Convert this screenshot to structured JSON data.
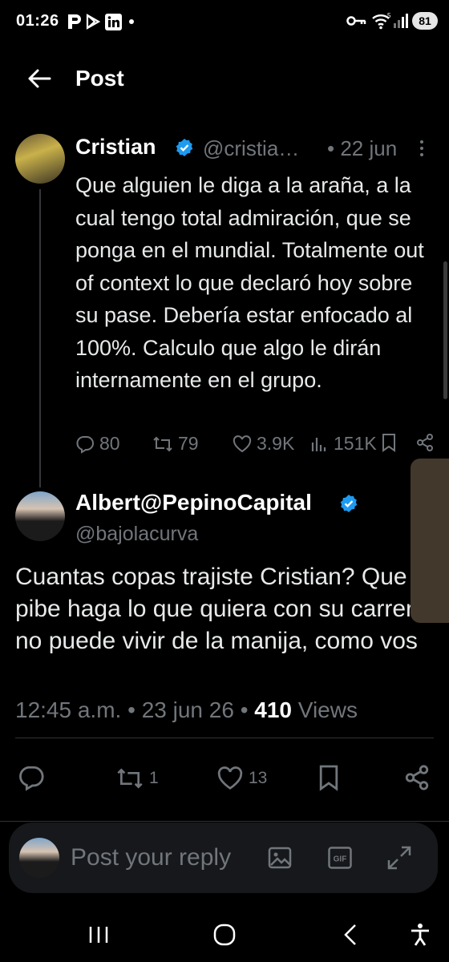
{
  "status_bar": {
    "time": "01:26",
    "battery": "81",
    "app_icons": [
      "p-icon",
      "play-store-icon",
      "linkedin-icon",
      "notification-dot-icon"
    ],
    "system_icons": [
      "key-icon",
      "wifi-icon",
      "signal-icon"
    ]
  },
  "header": {
    "title": "Post"
  },
  "parent_tweet": {
    "name": "Cristian",
    "handle": "@cristia…",
    "date": "• 22 jun",
    "text": "Que alguien le diga a la araña, a la cual tengo total admiración, que se ponga en el mundial. Totalmente out of context lo que declaró hoy sobre su pase. Debería estar enfocado al 100%. Calculo que algo le dirán internamente en el grupo.",
    "replies": "80",
    "reposts": "79",
    "likes": "3.9K",
    "views": "151K"
  },
  "main_tweet": {
    "name": "Albert@PepinoCapital",
    "handle": "@bajolacurva",
    "text": "Cuantas copas trajiste Cristian? Que el pibe haga lo que quiera con su carrera, no puede vivir de la manija, como vos",
    "time": "12:45 a.m.",
    "date": "23 jun 26",
    "views_count": "410",
    "views_label": "Views",
    "reposts": "1",
    "likes": "13"
  },
  "reply_bar": {
    "placeholder": "Post your reply"
  },
  "colors": {
    "background": "#000000",
    "text": "#e7e9ea",
    "muted": "#71767b",
    "verified": "#1d9bf0",
    "divider": "#2f3336"
  }
}
